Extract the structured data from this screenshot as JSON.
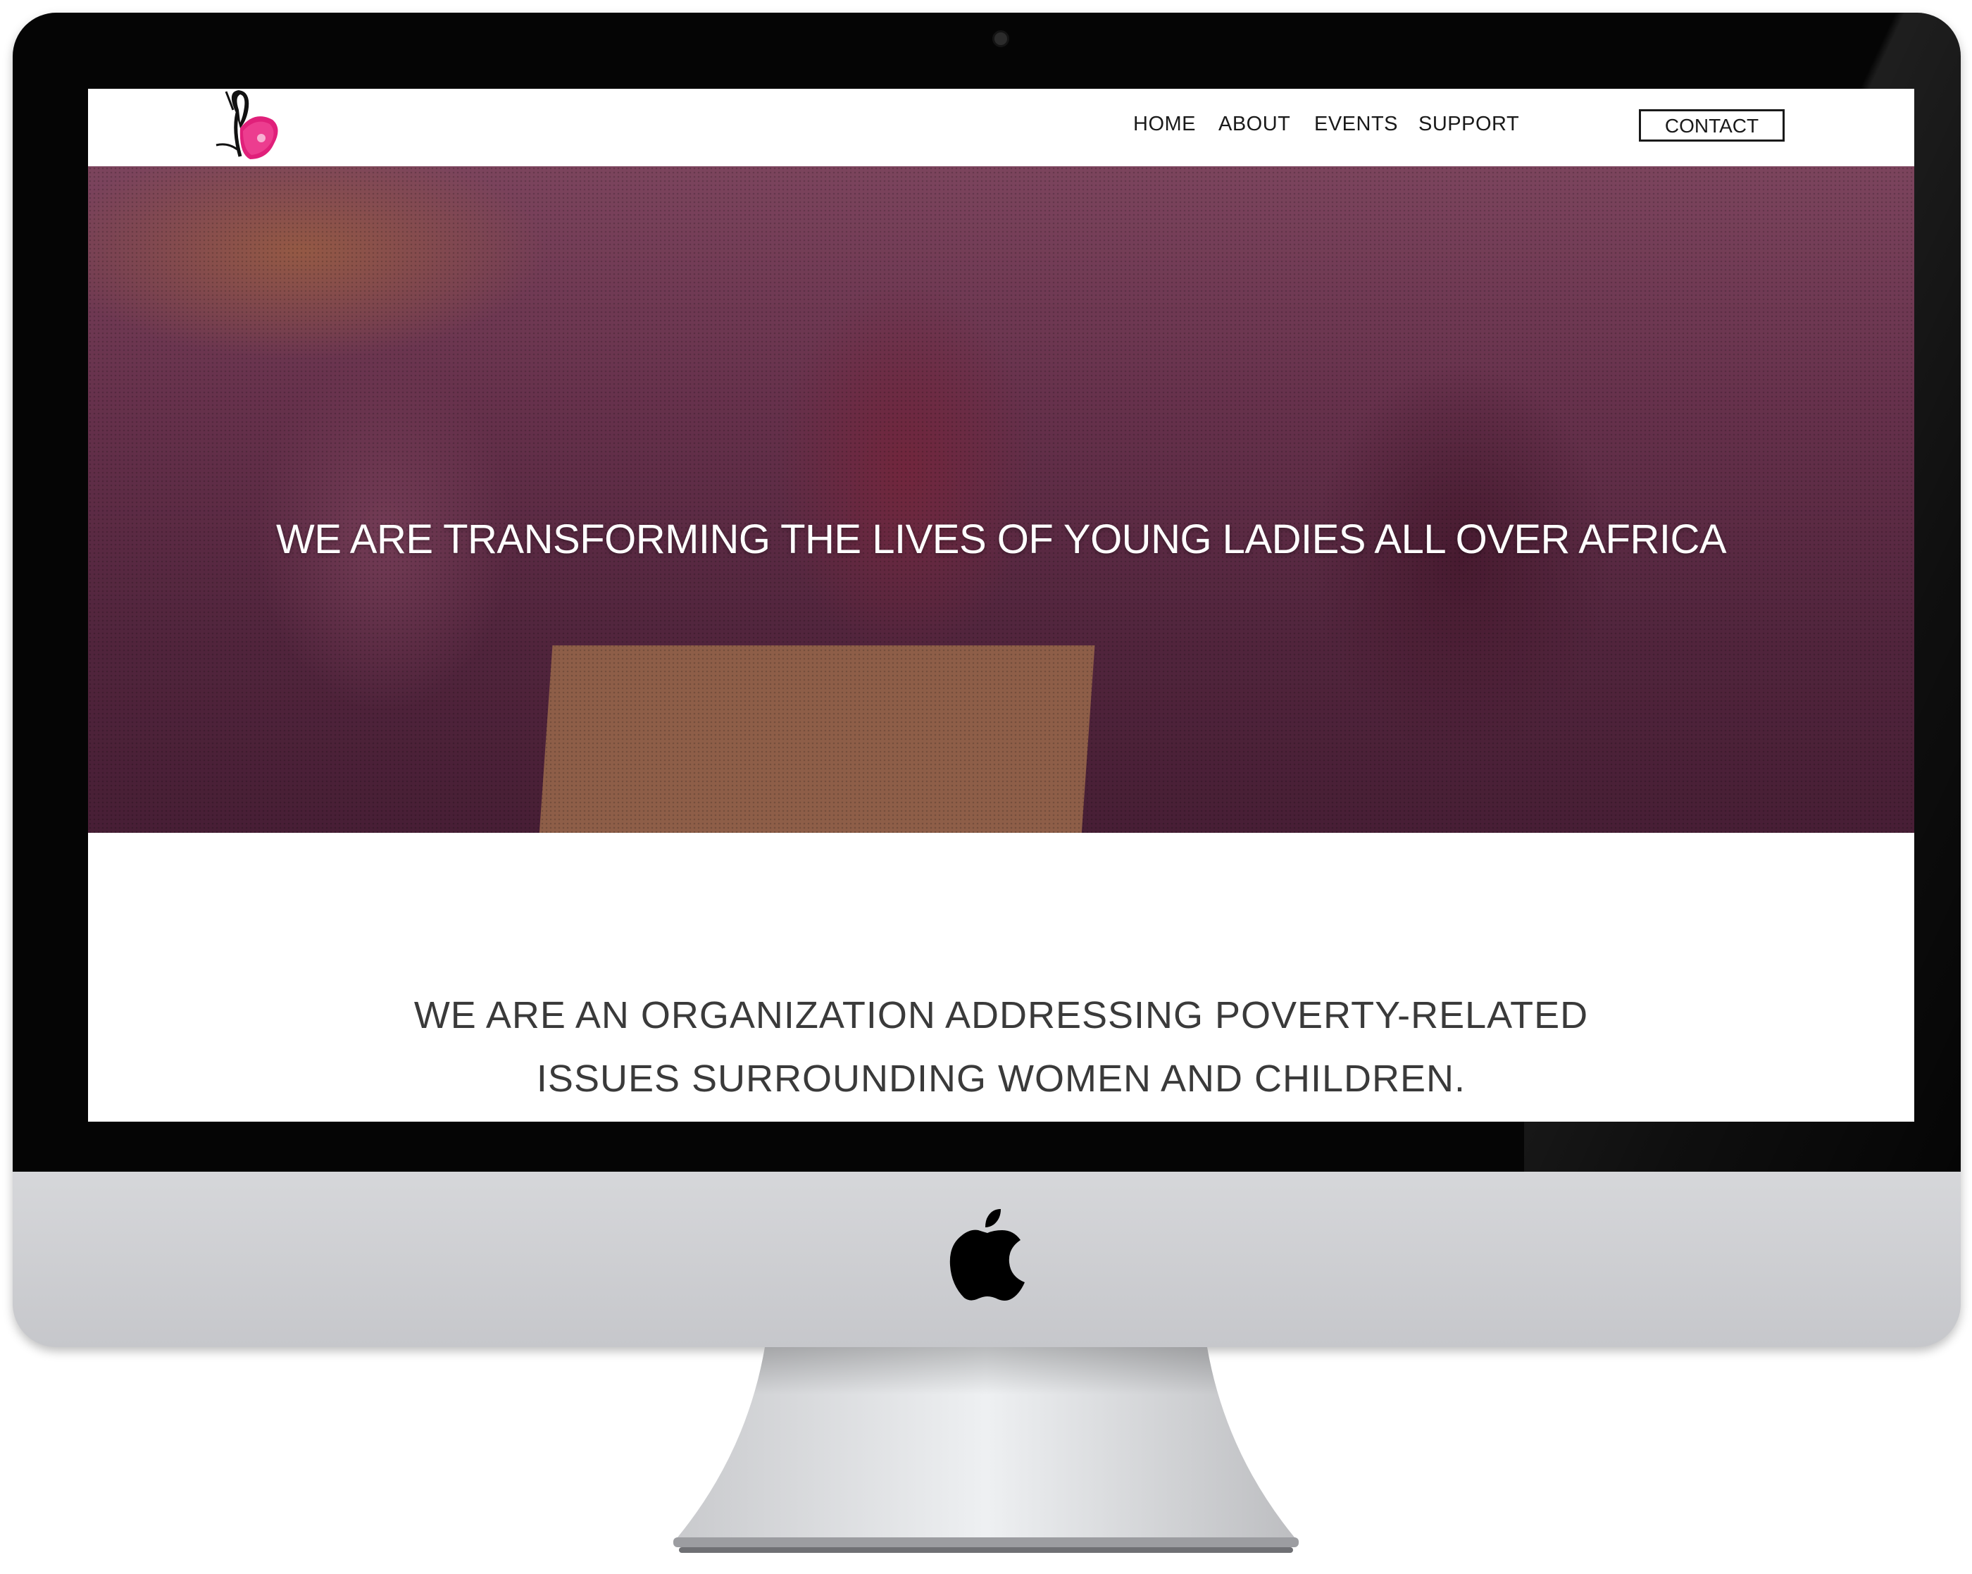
{
  "nav": {
    "home": "HOME",
    "about": "ABOUT",
    "events": "EVENTS",
    "support": "SUPPORT",
    "contact": "CONTACT"
  },
  "hero": {
    "headline": "WE ARE TRANSFORMING THE LIVES OF YOUNG LADIES ALL OVER AFRICA"
  },
  "mission": {
    "line1": "WE ARE AN ORGANIZATION ADDRESSING POVERTY-RELATED",
    "line2": "ISSUES SURROUNDING WOMEN AND CHILDREN."
  },
  "colors": {
    "brand_pink": "#e0207a",
    "hero_tint": "#601e3c",
    "bezel": "#050505",
    "chin": "#cfd0d3"
  },
  "icons": {
    "logo": "butterfly-logo-icon",
    "device": "apple-logo-icon"
  }
}
